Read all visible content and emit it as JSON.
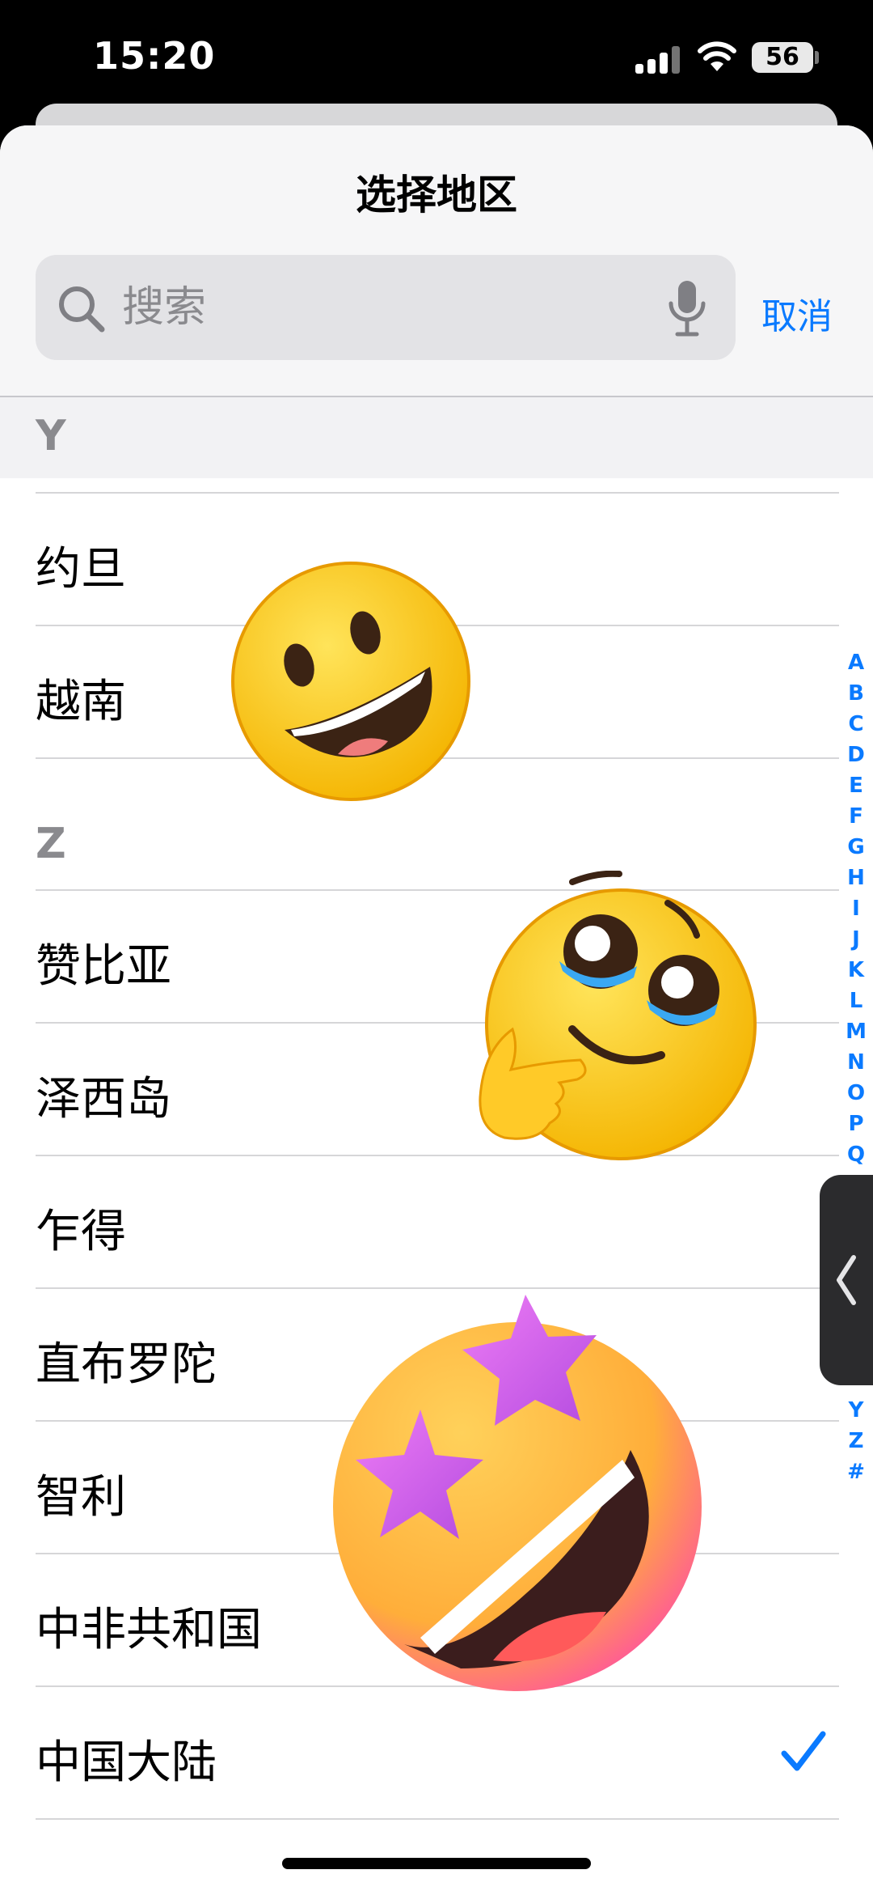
{
  "status_bar": {
    "time": "15:20",
    "battery": "56"
  },
  "sheet": {
    "title": "选择地区",
    "search": {
      "placeholder": "搜索"
    },
    "cancel_label": "取消"
  },
  "sections": [
    {
      "letter": "Y",
      "items": [
        "约旦",
        "越南"
      ]
    },
    {
      "letter": "Z",
      "items": [
        "赞比亚",
        "泽西岛",
        "乍得",
        "直布罗陀",
        "智利",
        "中非共和国",
        "中国大陆"
      ]
    }
  ],
  "selected_item": "中国大陆",
  "index_letters": [
    "A",
    "B",
    "C",
    "D",
    "E",
    "F",
    "G",
    "H",
    "I",
    "J",
    "K",
    "L",
    "M",
    "N",
    "O",
    "P",
    "Q"
  ],
  "index_letters_bottom": [
    "Y",
    "Z",
    "#"
  ],
  "colors": {
    "accent": "#0a7aff",
    "section_text": "#8a8a8e"
  },
  "stickers": [
    "grinning-face",
    "thinking-teary-face",
    "star-struck-face"
  ]
}
